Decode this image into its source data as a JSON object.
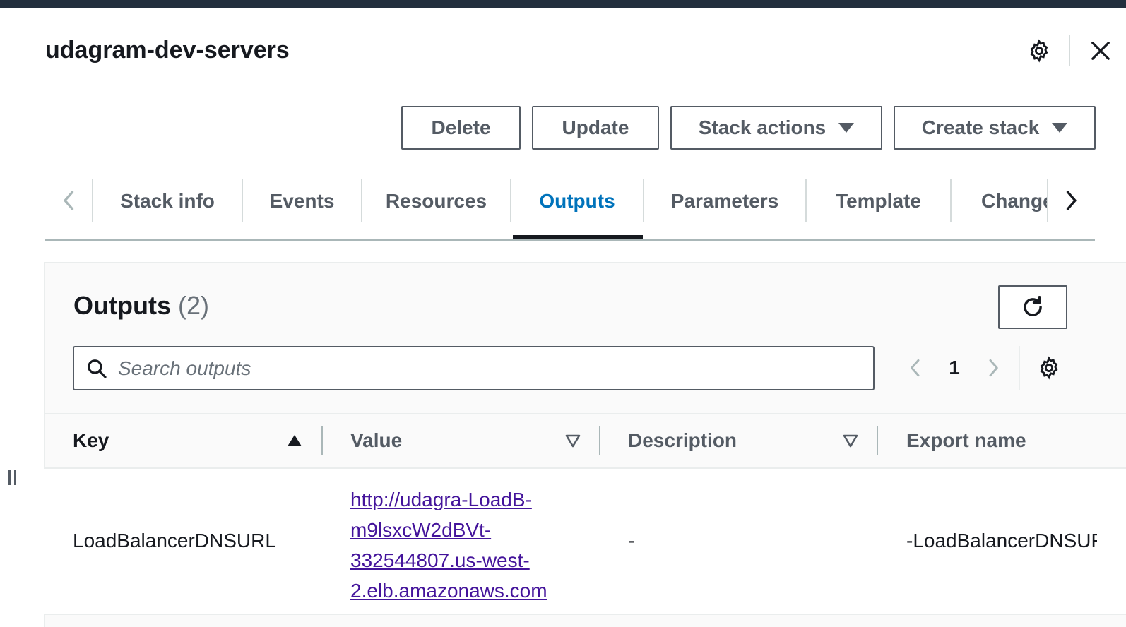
{
  "header": {
    "title": "udagram-dev-servers",
    "settings_icon": "gear-icon",
    "close_icon": "close-icon"
  },
  "actions": {
    "delete_label": "Delete",
    "update_label": "Update",
    "stack_actions_label": "Stack actions",
    "create_stack_label": "Create stack"
  },
  "tabs": {
    "items": [
      {
        "label": "Stack info"
      },
      {
        "label": "Events"
      },
      {
        "label": "Resources"
      },
      {
        "label": "Outputs",
        "active": true
      },
      {
        "label": "Parameters"
      },
      {
        "label": "Template"
      },
      {
        "label": "Change"
      }
    ]
  },
  "outputs": {
    "heading": "Outputs",
    "count": "(2)",
    "search_placeholder": "Search outputs",
    "search_value": "",
    "page_number": "1",
    "columns": {
      "key": "Key",
      "value": "Value",
      "description": "Description",
      "export_name": "Export name"
    },
    "rows": [
      {
        "key": "LoadBalancerDNSURL",
        "value_lines": [
          "http://udagra-LoadB-",
          "m9lsxcW2dBVt-",
          "332544807.us-west-",
          "2.elb.amazonaws.com"
        ],
        "description": "-",
        "export_name": "-LoadBalancerDNSURL"
      }
    ]
  },
  "colors": {
    "accent": "#0073bb",
    "link_visited": "#44149b",
    "topbar": "#232f3e",
    "text": "#16191f",
    "muted": "#545b64"
  }
}
